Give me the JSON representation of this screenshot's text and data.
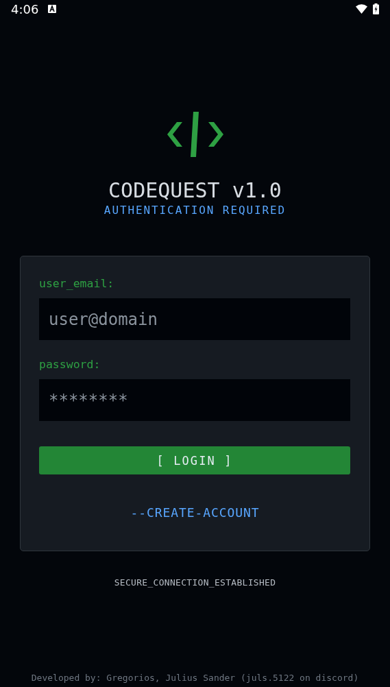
{
  "status_bar": {
    "time": "4:06"
  },
  "header": {
    "title": "CODEQUEST v1.0",
    "subtitle": "AUTHENTICATION REQUIRED"
  },
  "form": {
    "fields": [
      {
        "label": "user_email:",
        "placeholder": "user@domain"
      },
      {
        "label": "password:",
        "placeholder": "********"
      }
    ],
    "login_button": "[ LOGIN ]",
    "create_account_link": "--CREATE-ACCOUNT"
  },
  "connection_status": "SECURE_CONNECTION_ESTABLISHED",
  "footer": "Developed by: Gregorios, Julius Sander (juls.5122 on discord)"
}
